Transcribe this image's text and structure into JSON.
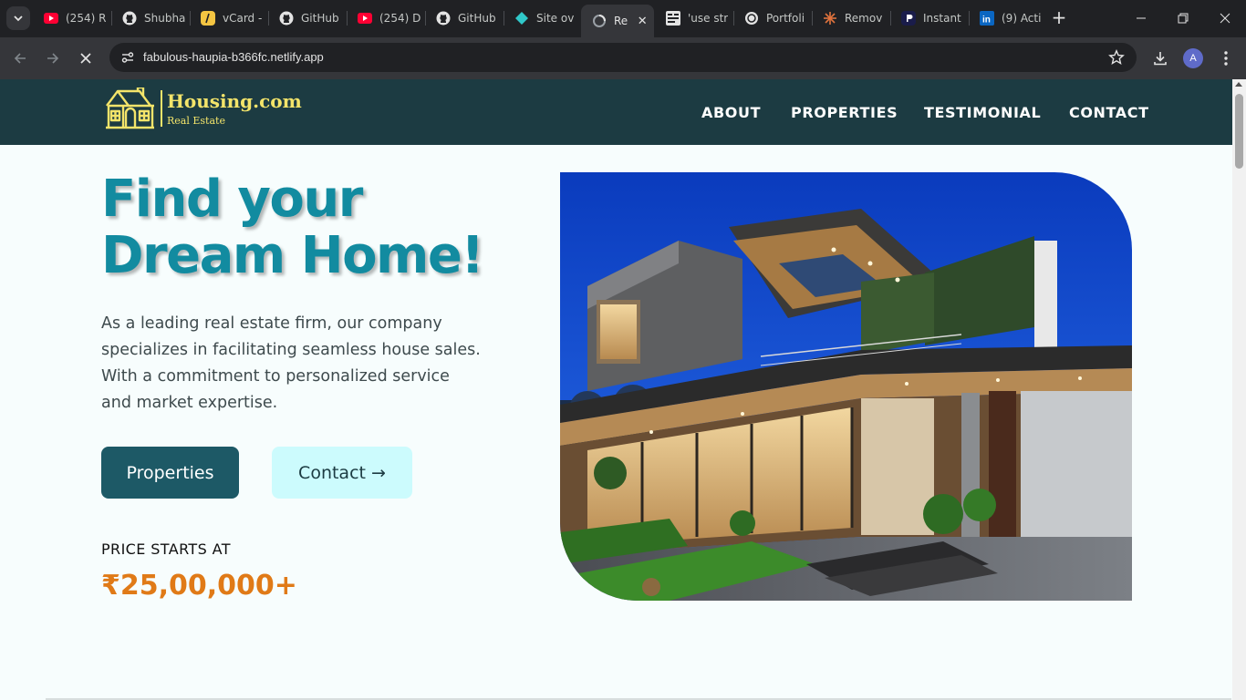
{
  "browser": {
    "tabs": [
      {
        "label": "(254) R",
        "icon": "youtube-icon"
      },
      {
        "label": "Shubha",
        "icon": "github-icon"
      },
      {
        "label": "vCard -",
        "icon": "vcard-icon"
      },
      {
        "label": "GitHub",
        "icon": "github-icon"
      },
      {
        "label": "(254) D",
        "icon": "youtube-icon"
      },
      {
        "label": "GitHub",
        "icon": "github-icon"
      },
      {
        "label": "Site ov",
        "icon": "netlify-icon"
      },
      {
        "label": "Re",
        "icon": "loading-icon",
        "active": true
      },
      {
        "label": "'use str",
        "icon": "code-icon"
      },
      {
        "label": "Portfoli",
        "icon": "portfolio-icon"
      },
      {
        "label": "Remov",
        "icon": "remove-icon"
      },
      {
        "label": "Instant",
        "icon": "instant-icon"
      },
      {
        "label": "(9) Acti",
        "icon": "linkedin-icon"
      }
    ],
    "url": "fabulous-haupia-b366fc.netlify.app",
    "profile_initial": "A"
  },
  "site": {
    "logo_title": "Housing.com",
    "logo_subtitle": "Real Estate",
    "nav": [
      "ABOUT",
      "PROPERTIES",
      "TESTIMONIAL",
      "CONTACT"
    ],
    "hero_title_line1": "Find your",
    "hero_title_line2": "Dream Home!",
    "hero_description": "As a leading real estate firm, our company specializes in facilitating seamless house sales. With a commitment to personalized service and market expertise.",
    "button_primary": "Properties",
    "button_secondary": "Contact →",
    "price_label": "PRICE STARTS AT",
    "price_value": "₹25,00,000+",
    "colors": {
      "header_bg": "#1c3b42",
      "logo": "#f3e46a",
      "title": "#128ba0",
      "primary_button": "#1d5966",
      "secondary_button": "#ccfbfd",
      "price": "#e07a17"
    }
  }
}
